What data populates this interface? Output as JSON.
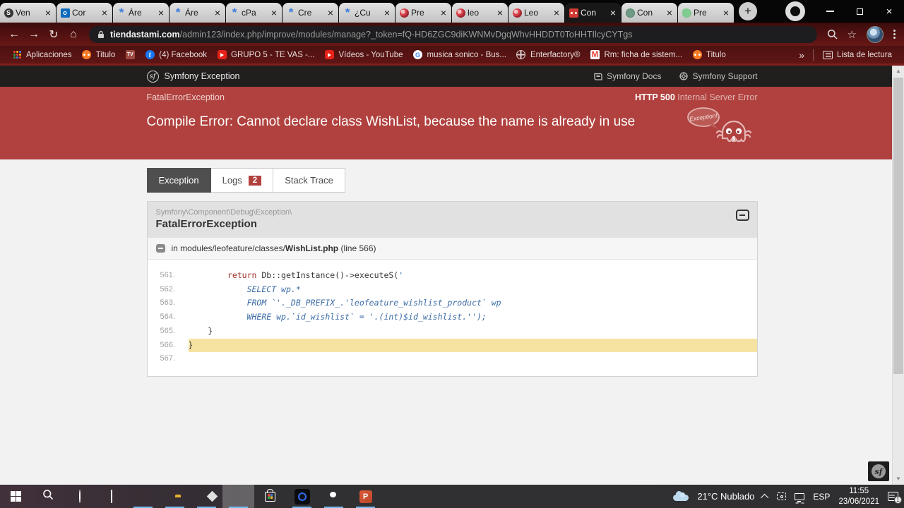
{
  "glyphs": {
    "close": "×",
    "plus": "+",
    "back": "←",
    "forward": "→",
    "reload": "↻",
    "home": "⌂",
    "star": "☆",
    "overflow": "»",
    "scroll_up": "▲",
    "scroll_down": "▼",
    "sf": "sf"
  },
  "browser": {
    "tabs": [
      {
        "title": "Ven",
        "icon": "circle-dark",
        "active": false
      },
      {
        "title": "Cor",
        "icon": "outlook",
        "active": false
      },
      {
        "title": "Áre",
        "icon": "flower-blue",
        "active": false
      },
      {
        "title": "Áre",
        "icon": "flower-blue",
        "active": false
      },
      {
        "title": "cPa",
        "icon": "flower-blue",
        "active": false
      },
      {
        "title": "Cre",
        "icon": "flower-blue",
        "active": false
      },
      {
        "title": "¿Cu",
        "icon": "flower-blue",
        "active": false
      },
      {
        "title": "Pre",
        "icon": "parrot",
        "active": false
      },
      {
        "title": "leo",
        "icon": "parrot",
        "active": false
      },
      {
        "title": "Leo",
        "icon": "parrot",
        "active": false
      },
      {
        "title": "Con",
        "icon": "ghost-red",
        "active": true
      },
      {
        "title": "Con",
        "icon": "globe-green",
        "active": false
      },
      {
        "title": "Pre",
        "icon": "leaf-green",
        "active": false
      }
    ],
    "nav": {
      "url_domain": "tiendastami.com",
      "url_path": "/admin123/index.php/improve/modules/manage?_token=fQ-HD6ZGC9diKWNMvDgqWhvHHDDT0ToHHTIlcyCYTgs"
    },
    "bookmarks": {
      "items": [
        {
          "label": "Aplicaciones",
          "icon": "apps-grid"
        },
        {
          "label": "Titulo",
          "icon": "xampp"
        },
        {
          "label": "",
          "icon": "tv"
        },
        {
          "label": "(4) Facebook",
          "icon": "facebook"
        },
        {
          "label": "GRUPO 5 - TE VAS -...",
          "icon": "youtube"
        },
        {
          "label": "Vídeos - YouTube",
          "icon": "youtube"
        },
        {
          "label": "musica sonico - Bus...",
          "icon": "google"
        },
        {
          "label": "Enterfactory®",
          "icon": "globe"
        },
        {
          "label": "Rm: ficha de sistem...",
          "icon": "gmail"
        },
        {
          "label": "Titulo",
          "icon": "xampp"
        }
      ],
      "reading_list": "Lista de lectura"
    }
  },
  "symfony": {
    "topbar": {
      "brand": "Symfony Exception",
      "links": [
        {
          "label": "Symfony Docs",
          "icon": "book"
        },
        {
          "label": "Symfony Support",
          "icon": "lifebuoy"
        }
      ]
    },
    "banner": {
      "exception_class": "FatalErrorException",
      "http_code": "HTTP 500",
      "http_text": "Internal Server Error",
      "message": "Compile Error: Cannot declare class WishList, because the name is already in use",
      "ghost_label": "Exception!"
    },
    "tabs": [
      {
        "label": "Exception",
        "active": true
      },
      {
        "label": "Logs",
        "badge": "2",
        "active": false
      },
      {
        "label": "Stack Trace",
        "active": false
      }
    ],
    "panel": {
      "namespace": "Symfony\\Component\\Debug\\Exception\\",
      "class_name": "FatalErrorException",
      "trace_prefix": "in modules/leofeature/classes/",
      "trace_file": "WishList.php",
      "trace_suffix": " (line 566)"
    },
    "code_lines": [
      {
        "no": "561.",
        "hl": false,
        "segs": [
          {
            "t": "        ",
            "c": "d"
          },
          {
            "t": "return",
            "c": "k"
          },
          {
            "t": " Db::getInstance()->executeS(",
            "c": "d"
          },
          {
            "t": "'",
            "c": "s"
          }
        ]
      },
      {
        "no": "562.",
        "hl": false,
        "segs": [
          {
            "t": "            SELECT wp.*",
            "c": "s"
          }
        ]
      },
      {
        "no": "563.",
        "hl": false,
        "segs": [
          {
            "t": "            FROM `'._DB_PREFIX_.'leofeature_wishlist_product` wp",
            "c": "s"
          }
        ]
      },
      {
        "no": "564.",
        "hl": false,
        "segs": [
          {
            "t": "            WHERE wp.`id_wishlist` = '.(int)$id_wishlist.'');",
            "c": "s"
          }
        ]
      },
      {
        "no": "565.",
        "hl": false,
        "segs": [
          {
            "t": "    }",
            "c": "d"
          }
        ]
      },
      {
        "no": "566.",
        "hl": true,
        "segs": [
          {
            "t": "}",
            "c": "d"
          }
        ]
      },
      {
        "no": "567.",
        "hl": false,
        "segs": []
      }
    ]
  },
  "taskbar": {
    "apps": [
      {
        "name": "start",
        "running": false,
        "active": false
      },
      {
        "name": "search",
        "running": false,
        "active": false
      },
      {
        "name": "cortana",
        "running": false,
        "active": false
      },
      {
        "name": "task-view",
        "running": false,
        "active": false
      },
      {
        "name": "edge",
        "running": true,
        "active": false
      },
      {
        "name": "file-explorer",
        "running": true,
        "active": false
      },
      {
        "name": "mail",
        "running": true,
        "active": false
      },
      {
        "name": "chrome",
        "running": true,
        "active": true
      },
      {
        "name": "store",
        "running": false,
        "active": false
      },
      {
        "name": "camera",
        "running": true,
        "active": false
      },
      {
        "name": "wechat",
        "running": true,
        "active": false
      },
      {
        "name": "powerpoint",
        "running": true,
        "active": false
      }
    ],
    "tray": {
      "weather_temp": "21°C",
      "weather_desc": "Nublado",
      "language": "ESP",
      "time": "11:55",
      "date": "23/06/2021",
      "notification_count": "1"
    }
  }
}
